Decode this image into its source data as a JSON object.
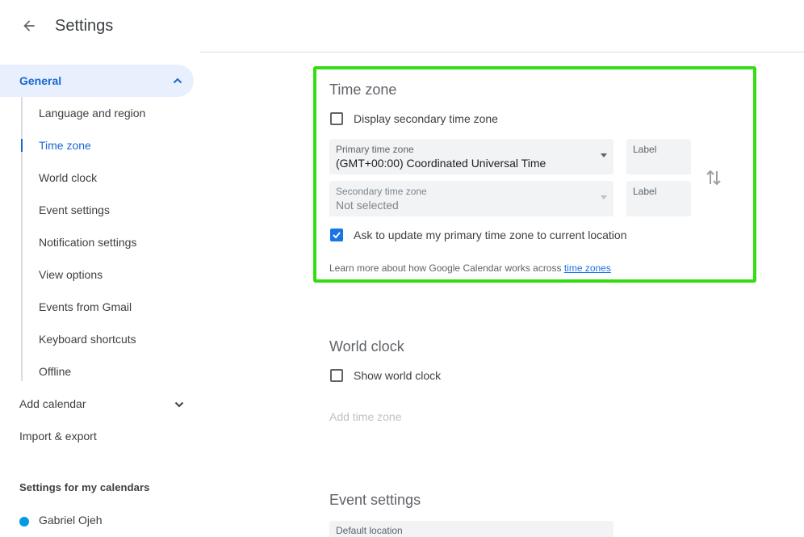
{
  "header": {
    "title": "Settings",
    "back_icon": "arrow-left-icon"
  },
  "sidebar": {
    "general": {
      "label": "General",
      "expanded": true
    },
    "sub_items": [
      {
        "label": "Language and region",
        "active": false
      },
      {
        "label": "Time zone",
        "active": true
      },
      {
        "label": "World clock",
        "active": false
      },
      {
        "label": "Event settings",
        "active": false
      },
      {
        "label": "Notification settings",
        "active": false
      },
      {
        "label": "View options",
        "active": false
      },
      {
        "label": "Events from Gmail",
        "active": false
      },
      {
        "label": "Keyboard shortcuts",
        "active": false
      },
      {
        "label": "Offline",
        "active": false
      }
    ],
    "add_calendar": "Add calendar",
    "import_export": "Import & export",
    "my_calendars_heading": "Settings for my calendars",
    "calendars": [
      {
        "name": "Gabriel Ojeh",
        "color": "#039be5"
      }
    ]
  },
  "time_zone": {
    "heading": "Time zone",
    "display_secondary": {
      "label": "Display secondary time zone",
      "checked": false
    },
    "primary": {
      "caption": "Primary time zone",
      "value": "(GMT+00:00) Coordinated Universal Time"
    },
    "primary_label_caption": "Label",
    "secondary": {
      "caption": "Secondary time zone",
      "value": "Not selected",
      "disabled": true
    },
    "secondary_label_caption": "Label",
    "ask_update": {
      "label": "Ask to update my primary time zone to current location",
      "checked": true
    },
    "learn_more_text": "Learn more about how Google Calendar works across",
    "learn_more_link": "time zones"
  },
  "world_clock": {
    "heading": "World clock",
    "show": {
      "label": "Show world clock",
      "checked": false
    },
    "add_time_zone": "Add time zone"
  },
  "event_settings": {
    "heading": "Event settings",
    "partial_caption": "Default location"
  },
  "colors": {
    "accent": "#1a73e8",
    "active_nav_bg": "#e8f0fe",
    "highlight_box": "#33dd11"
  }
}
